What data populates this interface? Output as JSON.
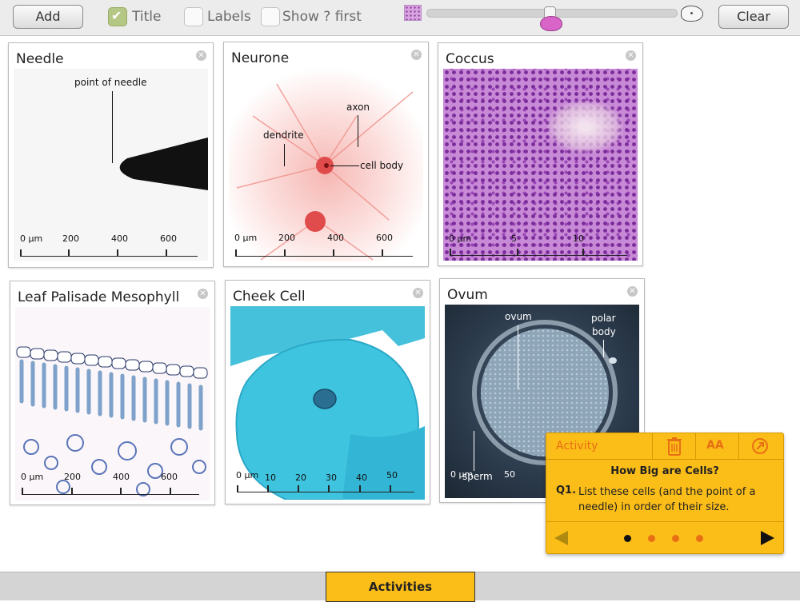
{
  "toolbar": {
    "add_label": "Add",
    "title_label": "Title",
    "title_checked": true,
    "labels_label": "Labels",
    "labels_checked": false,
    "show_first_label": "Show ? first",
    "show_first_checked": false,
    "clear_label": "Clear",
    "zoom_fraction": 0.49
  },
  "cards": {
    "needle": {
      "title": "Needle",
      "labels": [
        "point of needle"
      ],
      "scale": [
        "0 µm",
        "200",
        "400",
        "600"
      ]
    },
    "neurone": {
      "title": "Neurone",
      "labels": [
        "axon",
        "dendrite",
        "cell body"
      ],
      "scale": [
        "0 µm",
        "200",
        "400",
        "600"
      ]
    },
    "coccus": {
      "title": "Coccus",
      "scale": [
        "0 µm",
        "5",
        "10"
      ]
    },
    "leaf": {
      "title": "Leaf Palisade Mesophyll",
      "scale": [
        "0 µm",
        "200",
        "400",
        "600"
      ]
    },
    "cheek": {
      "title": "Cheek Cell",
      "scale": [
        "0 µm",
        "10",
        "20",
        "30",
        "40",
        "50"
      ]
    },
    "ovum": {
      "title": "Ovum",
      "labels": [
        "ovum",
        "polar",
        "body",
        "sperm"
      ],
      "scale": [
        "0 µm",
        "50"
      ]
    }
  },
  "activity": {
    "tab_label": "Activity",
    "font_button_label": "AA",
    "heading": "How Big are Cells?",
    "question_number": "Q1.",
    "question_text": "List these cells (and the point of a needle) in order of their size.",
    "page_count": 4,
    "current_page": 1
  },
  "bottom": {
    "activities_label": "Activities"
  },
  "colors": {
    "accent": "#fbbd18",
    "dot": "#e96f14"
  }
}
